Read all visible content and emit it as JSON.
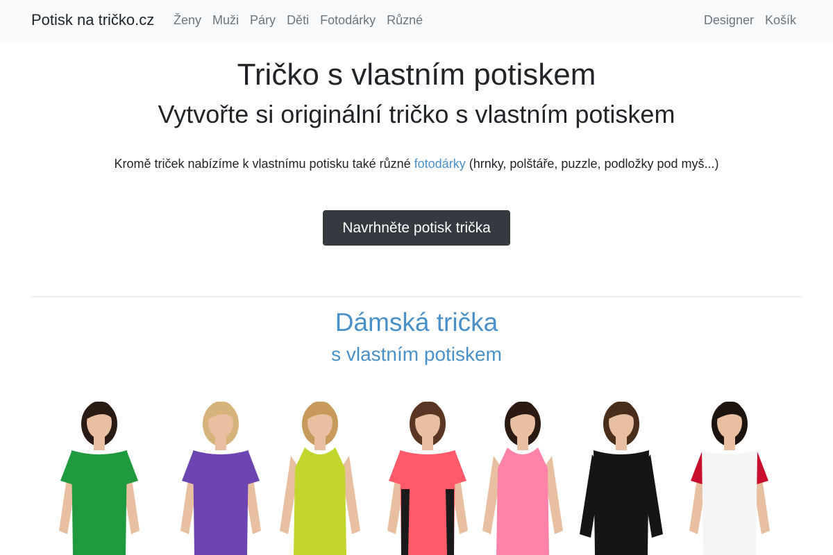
{
  "navbar": {
    "brand": "Potisk na tričko.cz",
    "left_links": [
      "Ženy",
      "Muži",
      "Páry",
      "Děti",
      "Fotodárky",
      "Různé"
    ],
    "right_links": [
      "Designer",
      "Košík"
    ]
  },
  "hero": {
    "title": "Tričko s vlastním potiskem",
    "subtitle": "Vytvořte si originální tričko s vlastním potiskem",
    "text_before": "Kromě triček nabízíme k vlastnímu potisku také různé ",
    "link": "fotodárky",
    "text_after": " (hrnky, polštáře, puzzle, podložky pod myš...)",
    "cta": "Navrhněte potisk trička"
  },
  "section": {
    "title": "Dámská trička",
    "subtitle": "s vlastním potiskem"
  },
  "models": [
    {
      "shirt": "#1f9a3f",
      "hair": "#2a1c14",
      "style": "tee"
    },
    {
      "shirt": "#6c45b2",
      "hair": "#d6b37a",
      "style": "tee"
    },
    {
      "shirt": "#c3d62e",
      "hair": "#c79a5c",
      "style": "tank"
    },
    {
      "shirt": "#ff5a6a",
      "hair": "#5b3524",
      "style": "sport"
    },
    {
      "shirt": "#ff82a8",
      "hair": "#2b1a12",
      "style": "tank"
    },
    {
      "shirt": "#151515",
      "hair": "#4a2e1c",
      "style": "longsleeve"
    },
    {
      "shirt": "#f5f5f5",
      "sleeve": "#c8102e",
      "hair": "#1d1410",
      "style": "raglan"
    }
  ],
  "colors": {
    "accent": "#4a90c8",
    "cta_bg": "#343a40",
    "navbar_bg": "#f8f9fa",
    "nav_link": "#6c757d"
  }
}
